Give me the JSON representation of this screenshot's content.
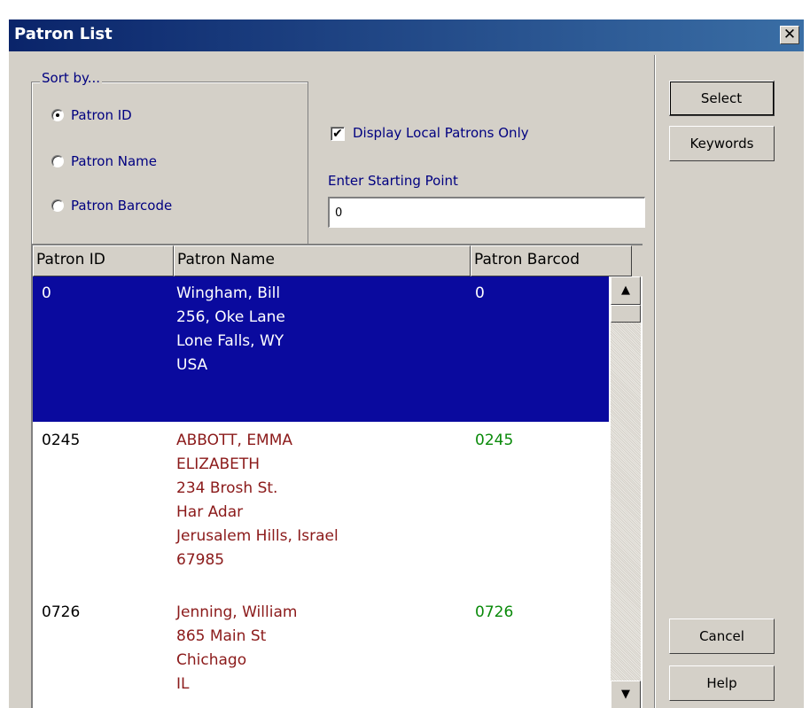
{
  "window": {
    "title": "Patron List",
    "close_glyph": "✕"
  },
  "sort": {
    "legend": "Sort by...",
    "options": [
      {
        "label": "Patron ID",
        "checked": true
      },
      {
        "label": "Patron Name",
        "checked": false
      },
      {
        "label": "Patron Barcode",
        "checked": false
      }
    ]
  },
  "filter": {
    "display_local_label": "Display Local Patrons Only",
    "display_local_checked": true,
    "start_label": "Enter Starting Point",
    "start_value": "0"
  },
  "list": {
    "columns": [
      "Patron ID",
      "Patron Name",
      "Patron Barcod"
    ],
    "rows": [
      {
        "id": "0",
        "name": "Wingham, Bill\n256, Oke Lane\nLone Falls, WY\nUSA",
        "barcode": "0",
        "selected": true
      },
      {
        "id": "0245",
        "name": "ABBOTT, EMMA\nELIZABETH\n234 Brosh St.\nHar Adar\nJerusalem Hills, Israel\n67985",
        "barcode": "0245",
        "selected": false
      },
      {
        "id": "0726",
        "name": "Jenning, William\n865 Main St\nChichago\nIL",
        "barcode": "0726",
        "selected": false
      }
    ]
  },
  "buttons": {
    "select": "Select",
    "keywords": "Keywords",
    "cancel": "Cancel",
    "help": "Help"
  },
  "icons": {
    "scroll_up": "▲",
    "scroll_down": "▼",
    "check": "✔"
  },
  "colors": {
    "title_bar": "#0a246a",
    "selection": "#0a0a9e",
    "name_text": "#8b1a1a",
    "barcode_text": "#0a8a0a",
    "label_text": "#000080"
  }
}
